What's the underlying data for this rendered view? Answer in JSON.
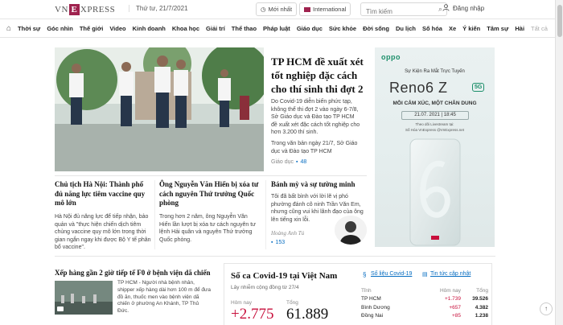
{
  "header": {
    "logo_left": "VN",
    "logo_mark": "E",
    "logo_right": "XPRESS",
    "date": "Thứ tư, 21/7/2021",
    "latest_label": "Mới nhất",
    "international_label": "International",
    "search_placeholder": "Tìm kiếm",
    "login_label": "Đăng nhập"
  },
  "nav": {
    "items": [
      "Thời sự",
      "Góc nhìn",
      "Thế giới",
      "Video",
      "Kinh doanh",
      "Khoa học",
      "Giải trí",
      "Thể thao",
      "Pháp luật",
      "Giáo dục",
      "Sức khỏe",
      "Đời sống",
      "Du lịch",
      "Số hóa",
      "Xe",
      "Ý kiến",
      "Tâm sự",
      "Hài"
    ],
    "more_label": "Tất cả"
  },
  "hero": {
    "title": "TP HCM đề xuất xét tốt nghiệp đặc cách cho thí sinh thi đợt 2",
    "desc": "Do Covid-19 diễn biến phức tạp, không thể thi đợt 2 vào ngày 6-7/8, Sở Giáo dục và Đào tạo TP HCM đề xuất xét đặc cách tốt nghiệp cho hơn 3.200 thí sinh.",
    "desc2": "Trong văn bản ngày 21/7, Sở Giáo dục và Đào tạo TP HCM",
    "category": "Giáo dục",
    "comments": "48"
  },
  "ad": {
    "brand": "oppo",
    "event": "Sự Kiện Ra Mắt Trực Tuyến",
    "model": "Reno6 Z",
    "badge": "5G",
    "tagline": "MỖI CẢM XÚC, MỘT CHÂN DUNG",
    "when": "21.07. 2021 | 18:45",
    "livestream": "Theo dõi Livestream tại:",
    "partners": "Số Hóa VnExpress    @VnExpress.net"
  },
  "stories": [
    {
      "title": "Chủ tịch Hà Nội: Thành phố đủ năng lực tiêm vaccine quy mô lớn",
      "desc": "Hà Nội đủ năng lực để tiếp nhận, bảo quản và \"thực hiện chiến dịch tiêm chủng vaccine quy mô lớn trong thời gian ngắn ngay khi được Bộ Y tế phân bổ vaccine\"."
    },
    {
      "title": "Ông Nguyễn Văn Hiến bị xóa tư cách nguyên Thứ trưởng Quốc phòng",
      "desc": "Trong hơn 2 năm, ông Nguyễn Văn Hiến lần lượt bị xóa tư cách nguyên tư lệnh Hải quân và nguyên Thứ trưởng Quốc phòng."
    },
    {
      "title": "Bánh mỳ và sự tường minh",
      "desc": "Tôi đã bất bình với lời lẽ vị phó phường đánh cô ninh Trần Văn Em, nhưng cũng vui khi lãnh đạo của ông lên tiếng xin lỗi.",
      "author": "Hoàng Anh Tú",
      "comments": "153"
    }
  ],
  "bottom_story": {
    "title": "Xếp hàng gần 2 giờ tiếp tế F0 ở bệnh viện dã chiến",
    "desc": "TP HCM - Người nhà bệnh nhân, shipper xếp hàng dài hơn 100 m để đưa đồ ăn, thuốc men vào bệnh viện dã chiến ở phường An Khánh, TP Thủ Đức."
  },
  "covid": {
    "title": "Số ca Covid-19 tại Việt Nam",
    "subtitle": "Lây nhiễm cộng đồng từ 27/4",
    "today_label": "Hôm nay",
    "today_value": "+2.775",
    "total_label": "Tổng",
    "total_value": "61.889",
    "link1": "Số liệu Covid-19",
    "link2": "Tin tức cập nhật",
    "table_headers": [
      "Tỉnh",
      "Hôm nay",
      "Tổng"
    ],
    "rows": [
      [
        "TP HCM",
        "+1.739",
        "39.526"
      ],
      [
        "Bình Dương",
        "+657",
        "4.382"
      ],
      [
        "Đồng Nai",
        "+85",
        "1.238"
      ]
    ]
  }
}
